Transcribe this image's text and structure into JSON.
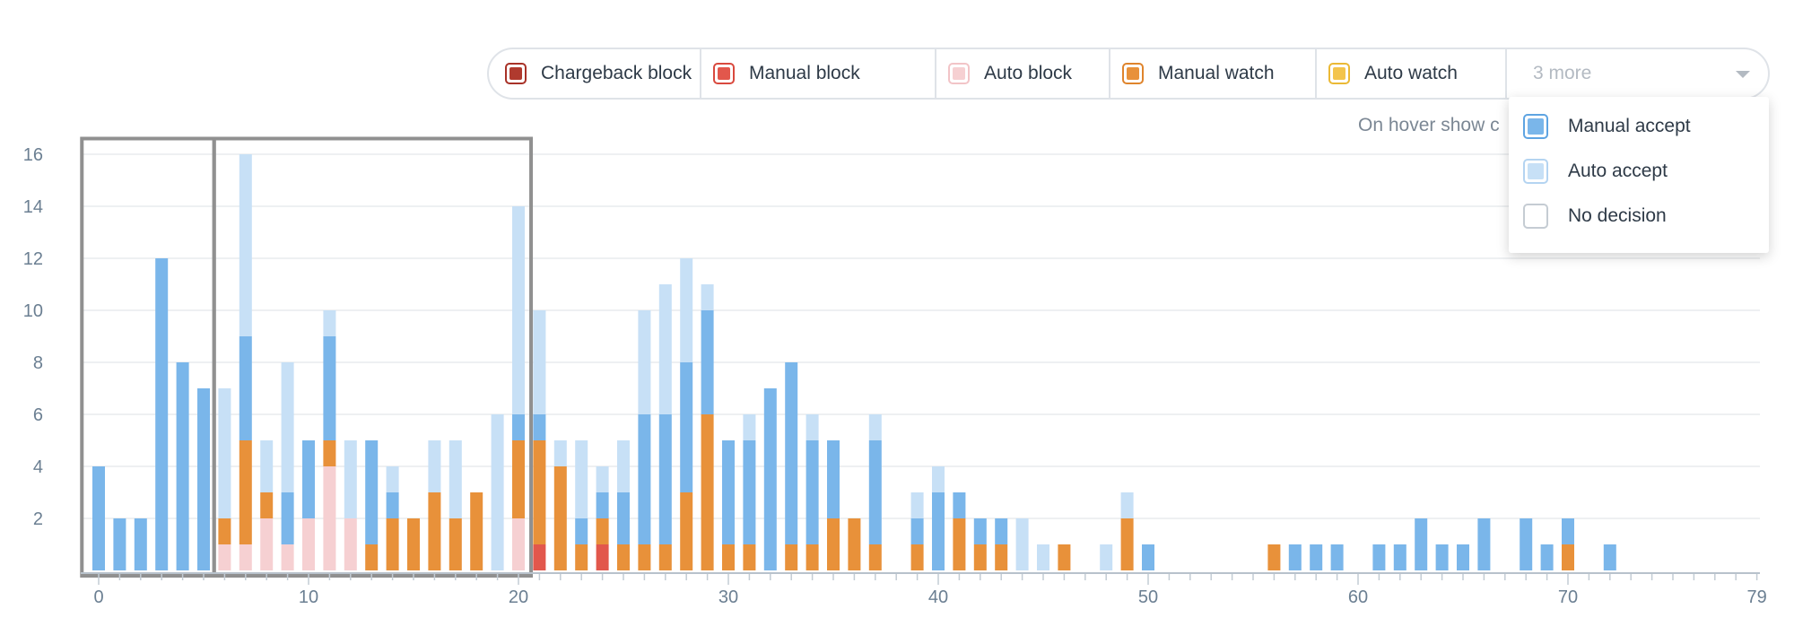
{
  "legend": {
    "items": [
      {
        "label": "Chargeback block",
        "color": "#b03a2e",
        "outline": "#a83228"
      },
      {
        "label": "Manual block",
        "color": "#e2574c",
        "outline": "#d9493e"
      },
      {
        "label": "Auto block",
        "color": "#f6d0d2",
        "outline": "#f2c4c7"
      },
      {
        "label": "Manual watch",
        "color": "#e8913a",
        "outline": "#df842c"
      },
      {
        "label": "Auto watch",
        "color": "#f3c44c",
        "outline": "#ebb935"
      }
    ],
    "more_label": "3 more",
    "more_icon": "chevron-down-icon"
  },
  "hover_note": "On hover show c",
  "dropdown": {
    "items": [
      {
        "label": "Manual accept",
        "color": "#7ab6ea",
        "outline": "#5ea4e2"
      },
      {
        "label": "Auto accept",
        "color": "#c7e0f6",
        "outline": "#b4d4f1"
      },
      {
        "label": "No decision",
        "color": "#ffffff",
        "outline": "#c5ccd3"
      }
    ]
  },
  "chart_data": {
    "type": "bar",
    "stacked": true,
    "xlim": [
      0,
      79
    ],
    "ylim": [
      0,
      16.5
    ],
    "x_ticks": [
      0,
      10,
      20,
      30,
      40,
      50,
      60,
      70,
      79
    ],
    "y_ticks": [
      2,
      4,
      6,
      8,
      10,
      12,
      14,
      16
    ],
    "grid": true,
    "series": [
      {
        "name": "Chargeback block",
        "color": "#b03a2e",
        "values": [
          0,
          0,
          0,
          0,
          0,
          0,
          0,
          0,
          0,
          0,
          0,
          0,
          0,
          0,
          0,
          0,
          0,
          0,
          0,
          0,
          0,
          0,
          0,
          0,
          0,
          0,
          0,
          0,
          0,
          0,
          0,
          0,
          0,
          0,
          0,
          0,
          0,
          0,
          0,
          0,
          0,
          0,
          0,
          0,
          0,
          0,
          0,
          0,
          0,
          0,
          0,
          0,
          0,
          0,
          0,
          0,
          0,
          0,
          0,
          0,
          0,
          0,
          0,
          0,
          0,
          0,
          0,
          0,
          0,
          0,
          0,
          0,
          0,
          0,
          0,
          0,
          0,
          0,
          0,
          0
        ]
      },
      {
        "name": "Manual block",
        "color": "#e2574c",
        "values": [
          0,
          0,
          0,
          0,
          0,
          0,
          0,
          0,
          0,
          0,
          0,
          0,
          0,
          0,
          0,
          0,
          0,
          0,
          0,
          0,
          0,
          1,
          0,
          0,
          1,
          0,
          0,
          0,
          0,
          0,
          0,
          0,
          0,
          0,
          0,
          0,
          0,
          0,
          0,
          0,
          0,
          0,
          0,
          0,
          0,
          0,
          0,
          0,
          0,
          0,
          0,
          0,
          0,
          0,
          0,
          0,
          0,
          0,
          0,
          0,
          0,
          0,
          0,
          0,
          0,
          0,
          0,
          0,
          0,
          0,
          0,
          0,
          0,
          0,
          0,
          0,
          0,
          0,
          0,
          0
        ]
      },
      {
        "name": "Auto block",
        "color": "#f6d0d2",
        "values": [
          0,
          0,
          0,
          0,
          0,
          0,
          1,
          1,
          2,
          1,
          2,
          4,
          2,
          0,
          0,
          0,
          0,
          0,
          0,
          0,
          2,
          0,
          0,
          0,
          0,
          0,
          0,
          0,
          0,
          0,
          0,
          0,
          0,
          0,
          0,
          0,
          0,
          0,
          0,
          0,
          0,
          0,
          0,
          0,
          0,
          0,
          0,
          0,
          0,
          0,
          0,
          0,
          0,
          0,
          0,
          0,
          0,
          0,
          0,
          0,
          0,
          0,
          0,
          0,
          0,
          0,
          0,
          0,
          0,
          0,
          0,
          0,
          0,
          0,
          0,
          0,
          0,
          0,
          0,
          0
        ]
      },
      {
        "name": "Manual watch",
        "color": "#e8913a",
        "values": [
          0,
          0,
          0,
          0,
          0,
          0,
          1,
          4,
          1,
          0,
          0,
          1,
          0,
          1,
          2,
          2,
          3,
          2,
          3,
          0,
          3,
          4,
          4,
          1,
          1,
          1,
          1,
          1,
          3,
          6,
          1,
          1,
          0,
          1,
          1,
          2,
          2,
          1,
          0,
          1,
          0,
          2,
          1,
          1,
          0,
          0,
          1,
          0,
          0,
          2,
          0,
          0,
          0,
          0,
          0,
          0,
          1,
          0,
          0,
          0,
          0,
          0,
          0,
          0,
          0,
          0,
          0,
          0,
          0,
          0,
          1,
          0,
          0,
          0,
          0,
          0,
          0,
          0,
          0,
          0
        ]
      },
      {
        "name": "Auto watch",
        "color": "#f3c44c",
        "values": [
          0,
          0,
          0,
          0,
          0,
          0,
          0,
          0,
          0,
          0,
          0,
          0,
          0,
          0,
          0,
          0,
          0,
          0,
          0,
          0,
          0,
          0,
          0,
          0,
          0,
          0,
          0,
          0,
          0,
          0,
          0,
          0,
          0,
          0,
          0,
          0,
          0,
          0,
          0,
          0,
          0,
          0,
          0,
          0,
          0,
          0,
          0,
          0,
          0,
          0,
          0,
          0,
          0,
          0,
          0,
          0,
          0,
          0,
          0,
          0,
          0,
          0,
          0,
          0,
          0,
          0,
          0,
          0,
          0,
          0,
          0,
          0,
          0,
          0,
          0,
          0,
          0,
          0,
          0,
          0
        ]
      },
      {
        "name": "Manual accept",
        "color": "#7ab6ea",
        "values": [
          4,
          2,
          2,
          12,
          8,
          7,
          0,
          4,
          0,
          2,
          3,
          4,
          0,
          4,
          1,
          0,
          0,
          0,
          0,
          0,
          1,
          1,
          0,
          1,
          1,
          2,
          5,
          5,
          5,
          4,
          4,
          4,
          7,
          7,
          4,
          3,
          0,
          4,
          0,
          1,
          3,
          1,
          1,
          1,
          0,
          0,
          0,
          0,
          0,
          0,
          1,
          0,
          0,
          0,
          0,
          0,
          0,
          1,
          1,
          1,
          0,
          1,
          1,
          2,
          1,
          1,
          2,
          0,
          2,
          1,
          1,
          0,
          1,
          0,
          0,
          0,
          0,
          0,
          0,
          0
        ]
      },
      {
        "name": "Auto accept",
        "color": "#c7e0f6",
        "values": [
          0,
          0,
          0,
          0,
          0,
          0,
          5,
          7,
          2,
          5,
          0,
          1,
          3,
          0,
          1,
          0,
          2,
          3,
          0,
          6,
          8,
          4,
          1,
          3,
          1,
          2,
          4,
          5,
          4,
          1,
          0,
          1,
          0,
          0,
          1,
          0,
          0,
          1,
          0,
          1,
          1,
          0,
          0,
          0,
          2,
          1,
          0,
          0,
          1,
          1,
          0,
          0,
          0,
          0,
          0,
          0,
          0,
          0,
          0,
          0,
          0,
          0,
          0,
          0,
          0,
          0,
          0,
          0,
          0,
          0,
          0,
          0,
          0,
          0,
          0,
          0,
          0,
          0,
          0,
          0
        ]
      },
      {
        "name": "No decision",
        "color": "#ffffff",
        "values": [
          0,
          0,
          0,
          0,
          0,
          0,
          0,
          0,
          0,
          0,
          0,
          0,
          0,
          0,
          0,
          0,
          0,
          0,
          0,
          0,
          0,
          0,
          0,
          0,
          0,
          0,
          0,
          0,
          0,
          0,
          0,
          0,
          0,
          0,
          0,
          0,
          0,
          0,
          0,
          0,
          0,
          0,
          0,
          0,
          0,
          0,
          0,
          0,
          0,
          0,
          0,
          0,
          0,
          0,
          0,
          0,
          0,
          0,
          0,
          0,
          0,
          0,
          0,
          0,
          0,
          0,
          0,
          0,
          0,
          0,
          0,
          0,
          0,
          0,
          0,
          0,
          0,
          0,
          0,
          0
        ]
      }
    ],
    "selections": [
      {
        "from": -0.8,
        "to": 5.5
      },
      {
        "from": 5.5,
        "to": 20.6
      }
    ]
  }
}
